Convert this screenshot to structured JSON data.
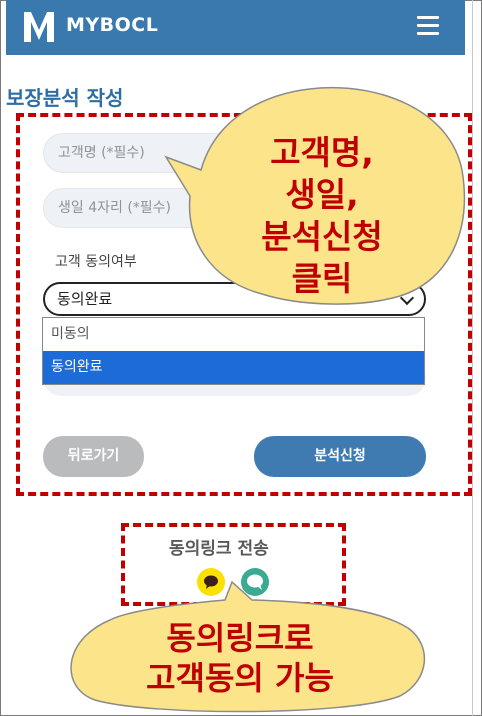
{
  "header": {
    "brand": "MYBOCL",
    "logo_icon": "m-logo-icon",
    "menu_icon": "hamburger-menu-icon",
    "background": "#3a79ad"
  },
  "page": {
    "title": "보장분석 작성"
  },
  "form": {
    "name_placeholder": "고객명 (*필수)",
    "birth_placeholder": "생일 4자리 (*필수)",
    "consent_label": "고객 동의여부",
    "consent_selected": "동의완료",
    "consent_options": [
      "미동의",
      "동의완료"
    ],
    "back_label": "뒤로가기",
    "submit_label": "분석신청"
  },
  "consent_link": {
    "title": "동의링크 전송",
    "kakao_icon": "kakaotalk-icon",
    "sms_icon": "message-icon"
  },
  "annotations": {
    "callout1_lines": [
      "고객명,",
      "생일,",
      "분석신청",
      "클릭"
    ],
    "callout2_lines": [
      "동의링크로",
      "고객동의 가능"
    ],
    "highlight_color": "#c00000",
    "bubble_color": "#fce48a"
  }
}
